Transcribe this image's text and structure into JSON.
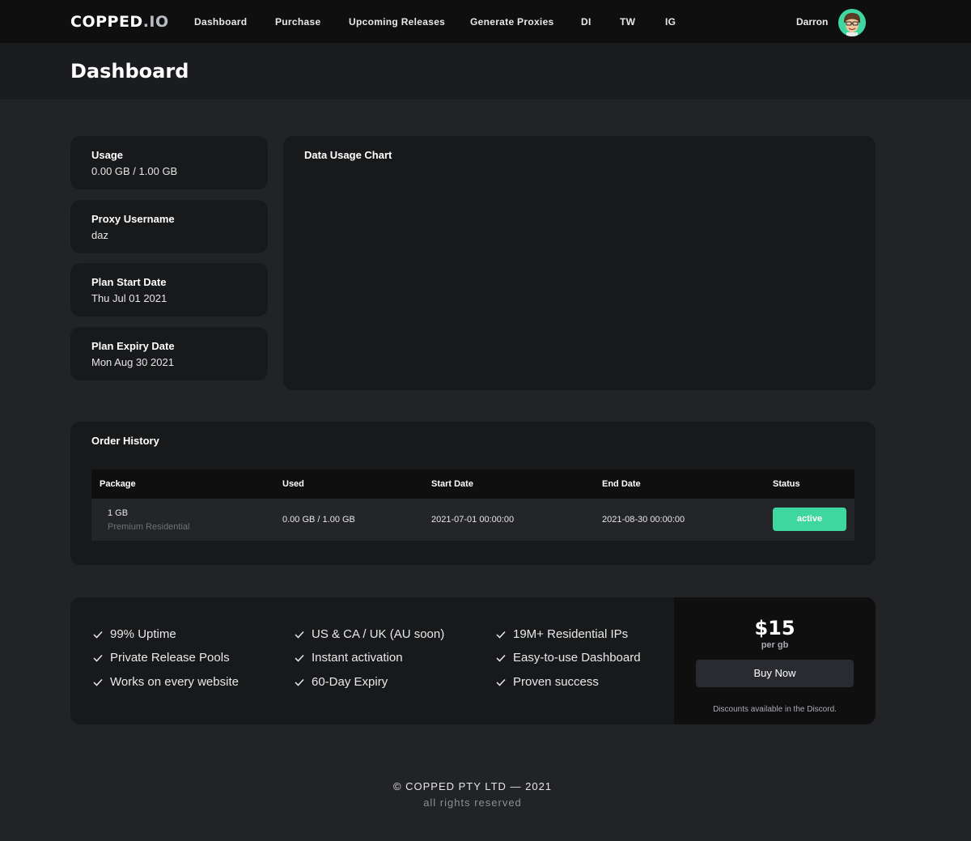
{
  "nav": {
    "logo_main": "COPPED",
    "logo_suffix": ".IO",
    "links": [
      "Dashboard",
      "Purchase",
      "Upcoming Releases",
      "Generate Proxies",
      "DI",
      "TW",
      "IG"
    ],
    "user_name": "Darron",
    "avatar_icon": "user-avatar-cartoon"
  },
  "header": {
    "title": "Dashboard"
  },
  "stats": [
    {
      "title": "Usage",
      "value": "0.00 GB / 1.00 GB"
    },
    {
      "title": "Proxy Username",
      "value": "daz"
    },
    {
      "title": "Plan Start Date",
      "value": "Thu Jul 01 2021"
    },
    {
      "title": "Plan Expiry Date",
      "value": "Mon Aug 30 2021"
    }
  ],
  "chart": {
    "title": "Data Usage Chart"
  },
  "orders": {
    "title": "Order History",
    "columns": [
      "Package",
      "Used",
      "Start Date",
      "End Date",
      "Status"
    ],
    "rows": [
      {
        "package": "1 GB",
        "package_type": "Premium Residential",
        "used": "0.00 GB / 1.00 GB",
        "start": "2021-07-01 00:00:00",
        "end": "2021-08-30 00:00:00",
        "status": "active"
      }
    ]
  },
  "plan": {
    "features": [
      "99% Uptime",
      "Private Release Pools",
      "Works on every website",
      "US & CA / UK (AU soon)",
      "Instant activation",
      "60-Day Expiry",
      "19M+ Residential IPs",
      "Easy-to-use Dashboard",
      "Proven success"
    ],
    "price": "$15",
    "unit": "per gb",
    "buy_label": "Buy Now",
    "discount_note": "Discounts available in the Discord."
  },
  "footer": {
    "line1": "© COPPED PTY LTD — 2021",
    "line2": "all rights reserved"
  },
  "colors": {
    "accent": "#3fd6a0",
    "background": "#222327",
    "card": "#18191b",
    "nav": "#0f0f10"
  }
}
